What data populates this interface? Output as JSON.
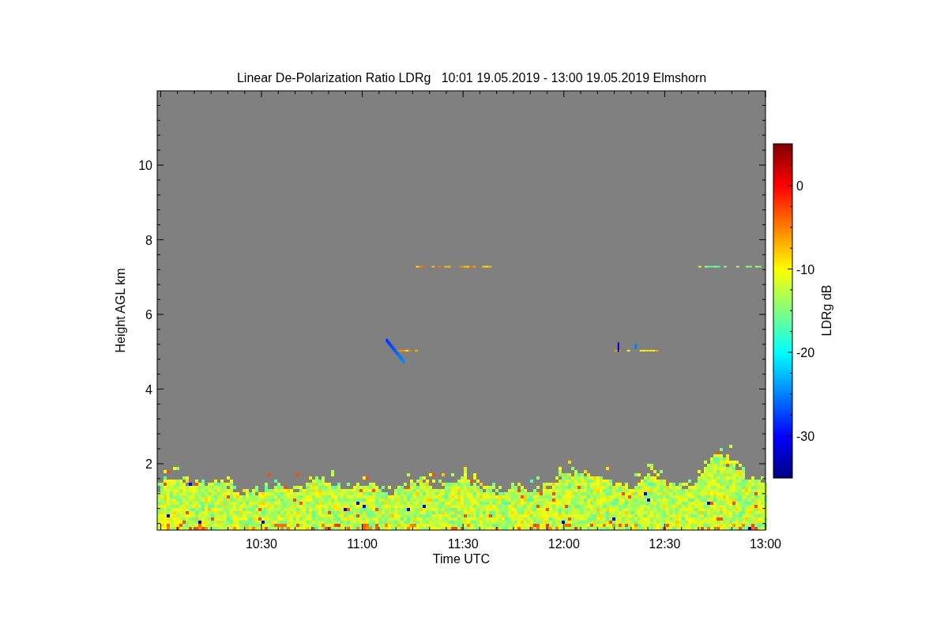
{
  "title": "Linear De-Polarization Ratio LDRg   10:01 19.05.2019 - 13:00 19.05.2019 Elmshorn",
  "plot": {
    "ylabel": "Height AGL km",
    "xlabel": "Time UTC",
    "yticks": [
      "10",
      "8",
      "6",
      "4",
      "2"
    ],
    "xticks": [
      "10:30",
      "11:00",
      "11:30",
      "12:00",
      "12:30",
      "13:00"
    ]
  },
  "colorbar": {
    "label": "LDRg dB",
    "ticks": [
      "0",
      "-10",
      "-20",
      "-30"
    ]
  }
}
